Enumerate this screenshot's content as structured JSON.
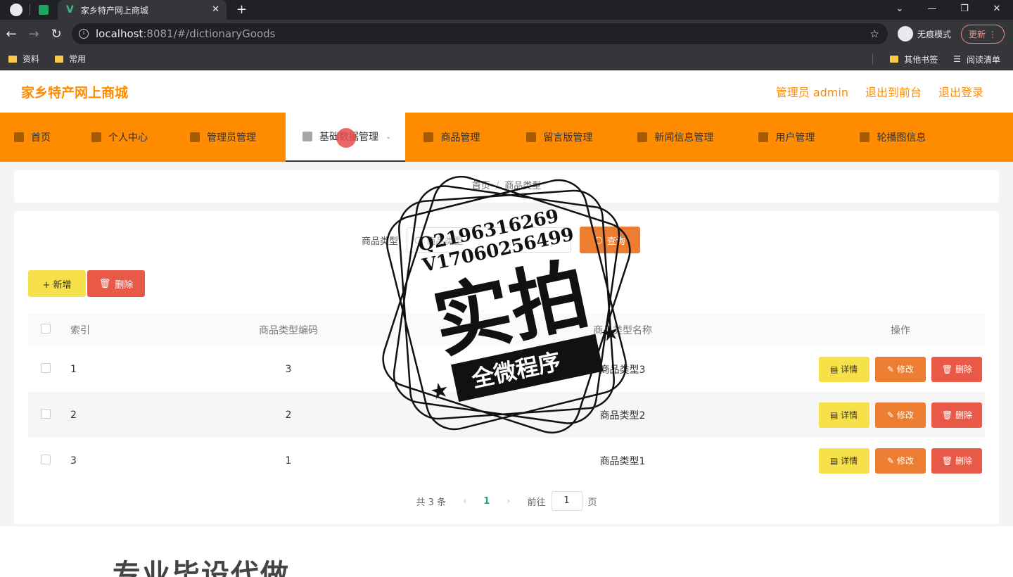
{
  "browser": {
    "tab_title": "家乡特产网上商城",
    "url_host": "localhost",
    "url_path": ":8081/#/dictionaryGoods",
    "incognito_label": "无痕模式",
    "update_label": "更新",
    "bookmarks": [
      "资料",
      "常用"
    ],
    "bookmarks_right": [
      "其他书签",
      "阅读清单"
    ]
  },
  "header": {
    "site_title": "家乡特产网上商城",
    "admin_label": "管理员 admin",
    "back_to_front": "退出到前台",
    "logout": "退出登录"
  },
  "nav": {
    "items": [
      {
        "label": "首页",
        "icon": "home-icon"
      },
      {
        "label": "个人中心",
        "icon": "user-icon"
      },
      {
        "label": "管理员管理",
        "icon": "admin-icon"
      },
      {
        "label": "基础数据管理",
        "icon": "clipboard-icon",
        "active": true
      },
      {
        "label": "商品管理",
        "icon": "flag-icon"
      },
      {
        "label": "留言版管理",
        "icon": "bars-icon"
      },
      {
        "label": "新闻信息管理",
        "icon": "gear-icon"
      },
      {
        "label": "用户管理",
        "icon": "people-icon"
      },
      {
        "label": "轮播图信息",
        "icon": "grid-icon"
      }
    ]
  },
  "breadcrumb": {
    "home": "首页",
    "current": "商品类型"
  },
  "search": {
    "label": "商品类型",
    "placeholder": "商品类型",
    "button": "查询"
  },
  "actions": {
    "add": "+ 新增",
    "delete": "删除"
  },
  "table": {
    "headers": {
      "index": "索引",
      "code": "商品类型编码",
      "name": "商品类型名称",
      "ops": "操作"
    },
    "rows": [
      {
        "index": "1",
        "code": "3",
        "name": "商品类型3"
      },
      {
        "index": "2",
        "code": "2",
        "name": "商品类型2"
      },
      {
        "index": "3",
        "code": "1",
        "name": "商品类型1"
      }
    ],
    "op_labels": {
      "detail": "详情",
      "edit": "修改",
      "remove": "删除"
    }
  },
  "pager": {
    "total": "共 3 条",
    "current": "1",
    "goto_prefix": "前往",
    "goto_value": "1",
    "goto_suffix": "页"
  },
  "watermark": {
    "line1": "Q2196316269",
    "line2": "V17060256499",
    "big": "实拍",
    "banner": "全微程序"
  },
  "footer_text": "专业毕设代做",
  "colors": {
    "brand": "#ff8c00",
    "yellow": "#f7e14b",
    "orange": "#ed7d31",
    "red": "#e85a47",
    "pager_active": "#1aa58a"
  }
}
